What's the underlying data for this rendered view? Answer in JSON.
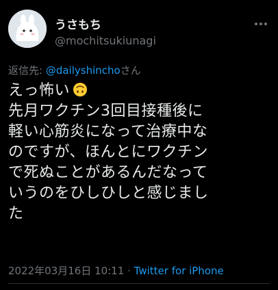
{
  "tweet": {
    "author": {
      "display_name": "うさもち",
      "handle": "@mochitsukiunagi",
      "avatar_icon": "white-rabbit-mochi-avatar"
    },
    "more_icon": "more-dots-icon",
    "reply": {
      "prefix": "返信先: ",
      "mention": "@dailyshincho",
      "suffix": "さん"
    },
    "body_lines": [
      "えっ怖い",
      "先月ワクチン3回目接種後に",
      "軽い心筋炎になって治療中な",
      "のですが、ほんとにワクチン",
      "で死ぬことがあるんだなって",
      "いうのをひしひしと感じまし",
      "た"
    ],
    "emoji": "upside-down-face-emoji",
    "timestamp": "2022年03月16日 10:11",
    "separator": " · ",
    "client": "Twitter for iPhone"
  },
  "colors": {
    "background": "#000000",
    "text": "#e7e9ea",
    "secondary_text": "#71767b",
    "link": "#1d9bf0",
    "divider": "#2f3336"
  }
}
